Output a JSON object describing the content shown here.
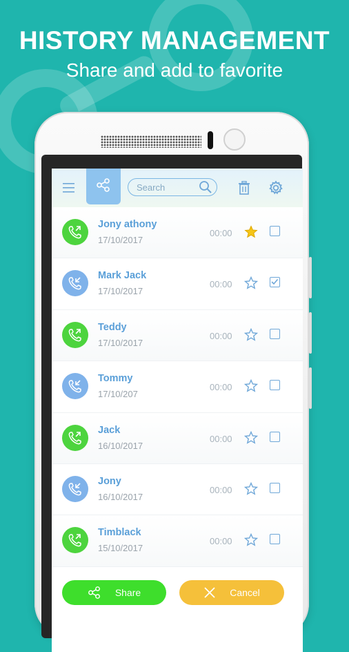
{
  "promo": {
    "headline": "HISTORY MANAGEMENT",
    "subline": "Share and add to favorite"
  },
  "toolbar": {
    "menu_icon": "hamburger-icon",
    "share_icon": "share-icon",
    "search_placeholder": "Search",
    "delete_icon": "trash-icon",
    "settings_icon": "gear-icon"
  },
  "calls": [
    {
      "name": "Jony athony",
      "date": "17/10/2017",
      "duration": "00:00",
      "direction": "outgoing",
      "favorite": true,
      "selected": false
    },
    {
      "name": "Mark Jack",
      "date": "17/10/2017",
      "duration": "00:00",
      "direction": "incoming",
      "favorite": false,
      "selected": true
    },
    {
      "name": "Teddy",
      "date": "17/10/2017",
      "duration": "00:00",
      "direction": "outgoing",
      "favorite": false,
      "selected": false
    },
    {
      "name": "Tommy",
      "date": "17/10/207",
      "duration": "00:00",
      "direction": "incoming",
      "favorite": false,
      "selected": false
    },
    {
      "name": "Jack",
      "date": "16/10/2017",
      "duration": "00:00",
      "direction": "outgoing",
      "favorite": false,
      "selected": false
    },
    {
      "name": "Jony",
      "date": "16/10/2017",
      "duration": "00:00",
      "direction": "incoming",
      "favorite": false,
      "selected": false
    },
    {
      "name": "Timblack",
      "date": "15/10/2017",
      "duration": "00:00",
      "direction": "outgoing",
      "favorite": false,
      "selected": false
    }
  ],
  "actions": {
    "share_label": "Share",
    "cancel_label": "Cancel"
  },
  "colors": {
    "background": "#1fb5ad",
    "outgoing": "#4dd43e",
    "incoming": "#7fb2ea",
    "favorite_star": "#f5c518",
    "share_button": "#3ede2c",
    "cancel_button": "#f5c03a"
  }
}
